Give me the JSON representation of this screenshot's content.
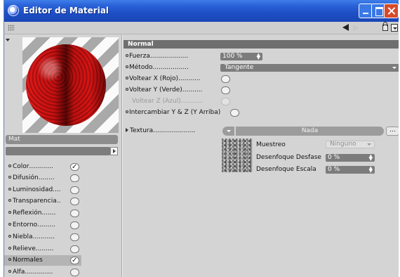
{
  "window": {
    "title": "Editor de Material"
  },
  "left": {
    "material_name": "Mat",
    "channels": [
      {
        "label": "Color",
        "leader": "............",
        "checked": true
      },
      {
        "label": "Difusión",
        "leader": "........",
        "checked": false
      },
      {
        "label": "Luminosidad",
        "leader": "....",
        "checked": false
      },
      {
        "label": "Transparencia",
        "leader": "..",
        "checked": false
      },
      {
        "label": "Reflexión",
        "leader": ".......",
        "checked": false
      },
      {
        "label": "Entorno",
        "leader": ".........",
        "checked": false
      },
      {
        "label": "Niebla",
        "leader": "...........",
        "checked": false
      },
      {
        "label": "Relieve",
        "leader": ".........",
        "checked": false
      },
      {
        "label": "Normales",
        "leader": "",
        "checked": true
      },
      {
        "label": "Alfa",
        "leader": "..............",
        "checked": false
      }
    ]
  },
  "right": {
    "section": "Normal",
    "fuerza": {
      "label": "Fuerza",
      "leader": "...................",
      "value": "100 %"
    },
    "metodo": {
      "label": "Método",
      "leader": "..................",
      "value": "Tangente"
    },
    "voltear_x": {
      "label": "Voltear X (Rojo)",
      "leader": "..........."
    },
    "voltear_y": {
      "label": "Voltear Y (Verde)",
      "leader": ".........."
    },
    "voltear_z": {
      "label": "Voltear Z (Azul)",
      "leader": "..........."
    },
    "intercambiar": {
      "label": "Intercambiar Y & Z (Y Arriba)"
    },
    "textura": {
      "label": "Textura",
      "leader": ".....................",
      "value": "Nada",
      "more": "...",
      "muestreo_label": "Muestreo",
      "muestreo_value": "Ninguno",
      "desenfoque_desfase_label": "Desenfoque Desfase",
      "desenfoque_desfase_value": "0 %",
      "desenfoque_escala_label": "Desenfoque Escala",
      "desenfoque_escala_value": "0 %"
    }
  }
}
